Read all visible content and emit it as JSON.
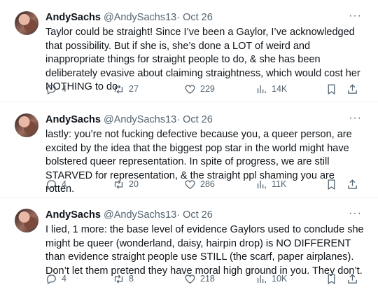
{
  "tweets": [
    {
      "author": "AndySachs",
      "handle": "@AndySachs13",
      "sep": "·",
      "date": "Oct 26",
      "text": "Taylor could be straight! Since I’ve been a Gaylor, I’ve acknowledged that possibility. But if she is, she’s done a LOT of weird and inappropriate things for straight people to do, & she has been deliberately evasive about claiming straightness, which would cost her NOTHING to do",
      "replies": "4",
      "retweets": "27",
      "likes": "229",
      "views": "14K"
    },
    {
      "author": "AndySachs",
      "handle": "@AndySachs13",
      "sep": "·",
      "date": "Oct 26",
      "text": "lastly: you’re not fucking defective because you, a queer person, are excited by the idea that the biggest pop star in the world might have bolstered queer representation. In spite of progress, we are still STARVED for representation, & the straight ppl shaming you are rotten.",
      "replies": "4",
      "retweets": "20",
      "likes": "286",
      "views": "11K"
    },
    {
      "author": "AndySachs",
      "handle": "@AndySachs13",
      "sep": "·",
      "date": "Oct 26",
      "text": "I lied, 1 more: the base level of evidence Gaylors used to conclude she might be queer (wonderland, daisy, hairpin drop) is NO DIFFERENT than evidence straight people use STILL (the scarf, paper airplanes). Don’t let them pretend they have moral high ground in you. They don’t.",
      "replies": "4",
      "retweets": "8",
      "likes": "218",
      "views": "10K"
    }
  ],
  "more_label": "···",
  "icons": [
    "reply-icon",
    "retweet-icon",
    "like-icon",
    "views-icon",
    "bookmark-icon",
    "share-icon"
  ]
}
